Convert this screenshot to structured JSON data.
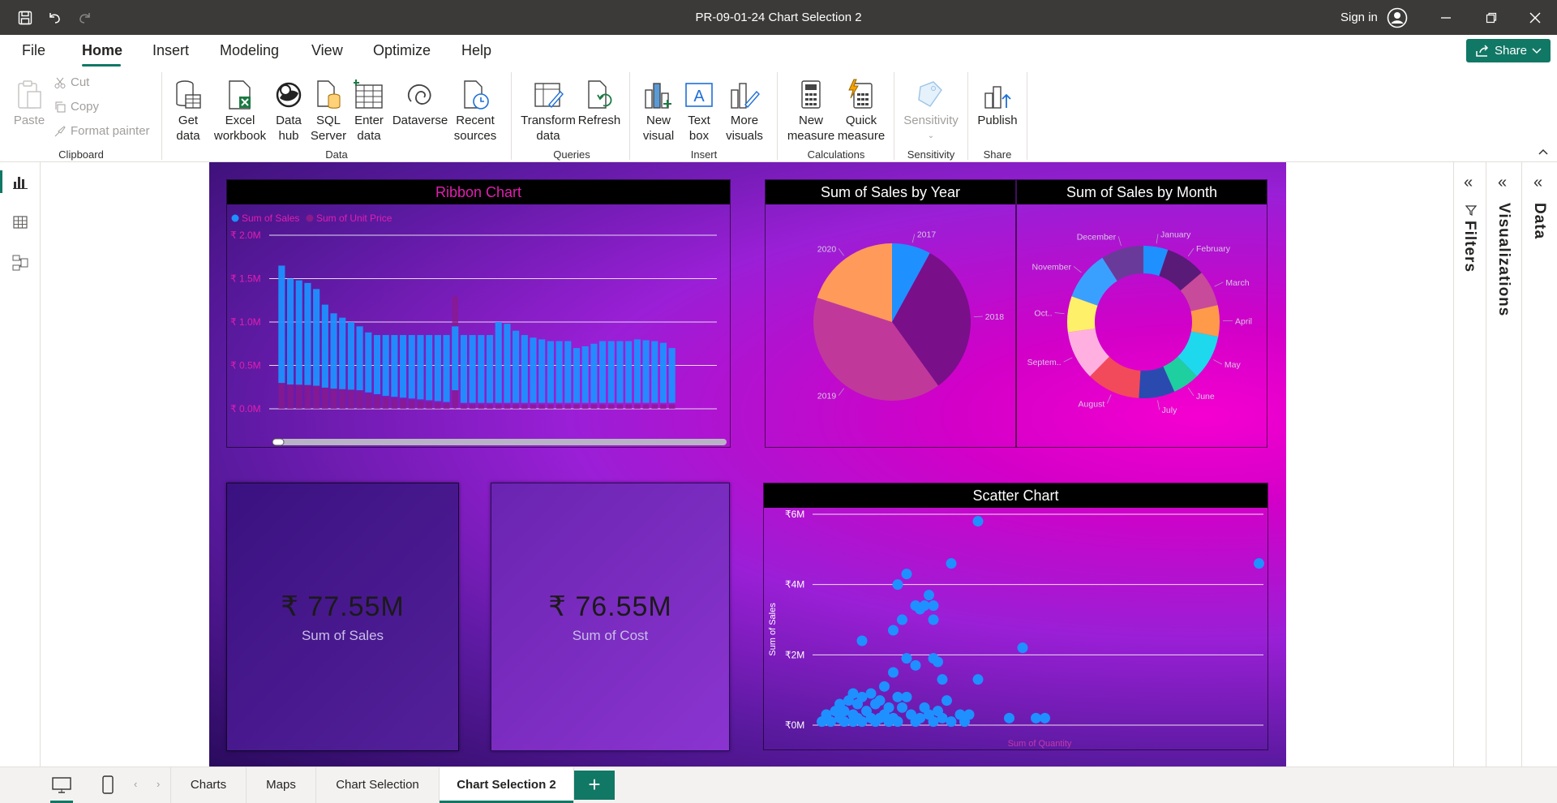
{
  "window": {
    "title": "PR-09-01-24 Chart Selection 2",
    "sign_in": "Sign in"
  },
  "menu": {
    "items": [
      "File",
      "Home",
      "Insert",
      "Modeling",
      "View",
      "Optimize",
      "Help"
    ],
    "active": "Home",
    "share": "Share"
  },
  "ribbon": {
    "clipboard": {
      "paste": "Paste",
      "cut": "Cut",
      "copy": "Copy",
      "format_painter": "Format painter",
      "label": "Clipboard"
    },
    "data": {
      "get_data": [
        "Get",
        "data"
      ],
      "excel": [
        "Excel",
        "workbook"
      ],
      "data_hub": [
        "Data",
        "hub"
      ],
      "sql": [
        "SQL",
        "Server"
      ],
      "enter_data": [
        "Enter",
        "data"
      ],
      "dataverse": "Dataverse",
      "recent": [
        "Recent",
        "sources"
      ],
      "label": "Data"
    },
    "queries": {
      "transform": [
        "Transform",
        "data"
      ],
      "refresh": "Refresh",
      "label": "Queries"
    },
    "insert": {
      "new_visual": [
        "New",
        "visual"
      ],
      "text_box": [
        "Text",
        "box"
      ],
      "more_visuals": [
        "More",
        "visuals"
      ],
      "label": "Insert"
    },
    "calculations": {
      "new_measure": [
        "New",
        "measure"
      ],
      "quick_measure": [
        "Quick",
        "measure"
      ],
      "label": "Calculations"
    },
    "sensitivity": {
      "button": "Sensitivity",
      "label": "Sensitivity"
    },
    "share": {
      "publish": "Publish",
      "label": "Share"
    }
  },
  "panes": {
    "filters": "Filters",
    "visualizations": "Visualizations",
    "data": "Data"
  },
  "pages": {
    "tabs": [
      "Charts",
      "Maps",
      "Chart Selection",
      "Chart Selection 2"
    ],
    "active": "Chart Selection 2",
    "add": "+"
  },
  "colors": {
    "accent": "#117865",
    "series_sales": "#1e90ff",
    "series_price": "#8b1a8b",
    "title_pink": "#e01fb0"
  },
  "cards": [
    {
      "value": "₹ 77.55M",
      "label": "Sum of Sales"
    },
    {
      "value": "₹ 76.55M",
      "label": "Sum of Cost"
    }
  ],
  "chart_data": [
    {
      "type": "area",
      "title": "Ribbon Chart",
      "legend": [
        "Sum of Sales",
        "Sum of Unit Price"
      ],
      "y_ticks": [
        "₹ 2.0M",
        "₹ 1.5M",
        "₹ 1.0M",
        "₹ 0.5M",
        "₹ 0.0M"
      ],
      "ylim": [
        0,
        2000000
      ],
      "series": [
        {
          "name": "Sum of Sales",
          "values": [
            1650000,
            1500000,
            1480000,
            1450000,
            1380000,
            1200000,
            1100000,
            1050000,
            1000000,
            950000,
            880000,
            850000,
            850000,
            850000,
            850000,
            850000,
            850000,
            850000,
            850000,
            850000,
            950000,
            850000,
            850000,
            850000,
            850000,
            1000000,
            980000,
            900000,
            850000,
            820000,
            800000,
            780000,
            780000,
            780000,
            700000,
            720000,
            750000,
            780000,
            780000,
            780000,
            780000,
            800000,
            790000,
            780000,
            760000,
            700000
          ]
        },
        {
          "name": "Sum of Unit Price",
          "values": [
            550000,
            480000,
            430000,
            400000,
            360000,
            320000,
            280000,
            250000,
            220000,
            200000,
            170000,
            150000,
            130000,
            120000,
            110000,
            100000,
            90000,
            80000,
            70000,
            60000,
            1300000,
            50000,
            50000,
            50000,
            50000,
            50000,
            50000,
            50000,
            50000,
            50000,
            50000,
            50000,
            50000,
            50000,
            50000,
            50000,
            50000,
            50000,
            50000,
            50000,
            50000,
            50000,
            50000,
            50000,
            50000,
            50000
          ]
        }
      ]
    },
    {
      "type": "pie",
      "title": "Sum of Sales by Year",
      "categories": [
        "2017",
        "2018",
        "2019",
        "2020"
      ],
      "values": [
        8,
        32,
        40,
        20
      ],
      "colors": [
        "#1e90ff",
        "#7a0f8a",
        "#c0399a",
        "#ff9a5a"
      ]
    },
    {
      "type": "pie",
      "title": "Sum of Sales by Month",
      "donut": true,
      "categories": [
        "January",
        "February",
        "March",
        "April",
        "May",
        "June",
        "July",
        "August",
        "Septem..",
        "Oct..",
        "November",
        "December"
      ],
      "values": [
        5.5,
        9,
        8,
        7,
        10,
        6,
        8,
        12,
        11,
        8,
        11,
        9.5
      ],
      "colors": [
        "#1e90ff",
        "#5a1a78",
        "#c84a9a",
        "#ff9a4a",
        "#1ed8ee",
        "#1ecfa0",
        "#2a4ab0",
        "#f24a5a",
        "#ffb0e0",
        "#fff06a",
        "#3aa0ff",
        "#6a3a9a"
      ]
    },
    {
      "type": "scatter",
      "title": "Scatter Chart",
      "xlabel": "Sum of Quantity",
      "ylabel": "Sum of Sales",
      "y_ticks": [
        "₹6M",
        "₹4M",
        "₹2M",
        "₹0M"
      ],
      "ylim": [
        0,
        6000000
      ],
      "xlim": [
        0,
        100
      ],
      "points": [
        [
          36,
          5800000
        ],
        [
          30,
          4600000
        ],
        [
          20,
          4300000
        ],
        [
          18,
          4000000
        ],
        [
          25,
          3700000
        ],
        [
          22,
          3400000
        ],
        [
          23,
          3300000
        ],
        [
          24,
          3400000
        ],
        [
          26,
          3400000
        ],
        [
          19,
          3000000
        ],
        [
          26,
          3000000
        ],
        [
          17,
          2700000
        ],
        [
          10,
          2400000
        ],
        [
          46,
          2200000
        ],
        [
          20,
          1900000
        ],
        [
          26,
          1900000
        ],
        [
          27,
          1800000
        ],
        [
          22,
          1700000
        ],
        [
          17,
          1500000
        ],
        [
          28,
          1300000
        ],
        [
          36,
          1300000
        ],
        [
          15,
          1100000
        ],
        [
          8,
          900000
        ],
        [
          10,
          800000
        ],
        [
          12,
          900000
        ],
        [
          14,
          700000
        ],
        [
          18,
          800000
        ],
        [
          20,
          800000
        ],
        [
          29,
          700000
        ],
        [
          5,
          600000
        ],
        [
          7,
          700000
        ],
        [
          9,
          600000
        ],
        [
          13,
          600000
        ],
        [
          16,
          500000
        ],
        [
          19,
          500000
        ],
        [
          24,
          500000
        ],
        [
          2,
          300000
        ],
        [
          4,
          400000
        ],
        [
          6,
          400000
        ],
        [
          8,
          300000
        ],
        [
          11,
          400000
        ],
        [
          15,
          300000
        ],
        [
          21,
          300000
        ],
        [
          25,
          300000
        ],
        [
          27,
          400000
        ],
        [
          32,
          300000
        ],
        [
          34,
          300000
        ],
        [
          2,
          200000
        ],
        [
          5,
          200000
        ],
        [
          9,
          200000
        ],
        [
          12,
          200000
        ],
        [
          14,
          200000
        ],
        [
          17,
          200000
        ],
        [
          23,
          200000
        ],
        [
          28,
          200000
        ],
        [
          43,
          200000
        ],
        [
          49,
          200000
        ],
        [
          51,
          200000
        ],
        [
          1,
          100000
        ],
        [
          3,
          100000
        ],
        [
          6,
          100000
        ],
        [
          8,
          100000
        ],
        [
          10,
          100000
        ],
        [
          13,
          100000
        ],
        [
          16,
          100000
        ],
        [
          18,
          100000
        ],
        [
          22,
          100000
        ],
        [
          26,
          100000
        ],
        [
          30,
          100000
        ],
        [
          33,
          100000
        ],
        [
          99,
          4600000
        ]
      ]
    }
  ]
}
